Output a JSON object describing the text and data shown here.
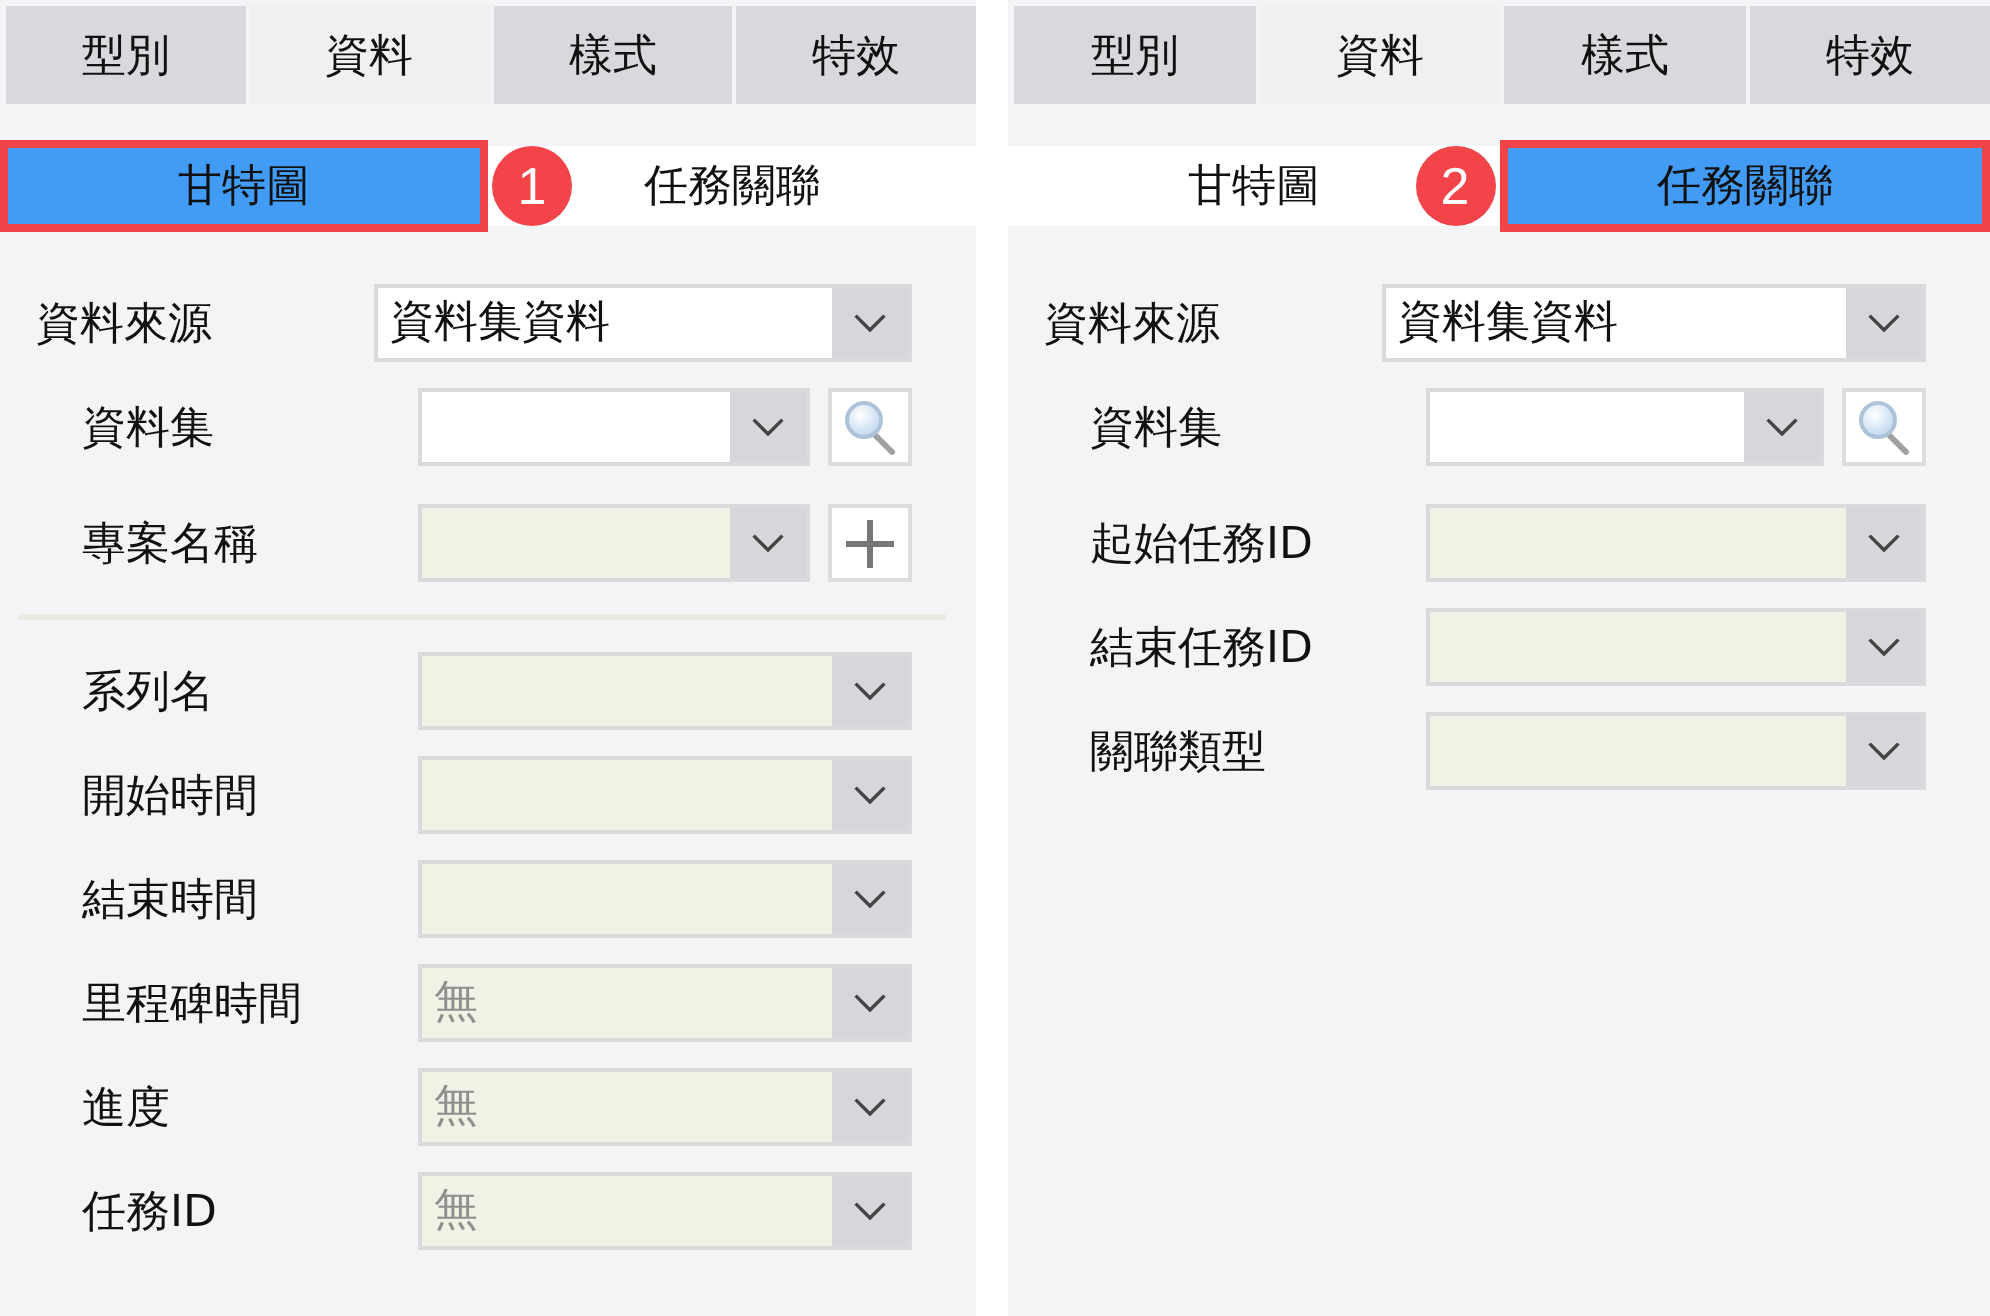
{
  "panels": [
    {
      "tabs": [
        {
          "label": "型別",
          "selected": false
        },
        {
          "label": "資料",
          "selected": true
        },
        {
          "label": "樣式",
          "selected": false
        },
        {
          "label": "特效",
          "selected": false
        }
      ],
      "subtabs": [
        {
          "label": "甘特圖",
          "selected": true,
          "highlighted": true,
          "badge": "1"
        },
        {
          "label": "任務關聯",
          "selected": false,
          "highlighted": false
        }
      ],
      "data_source": {
        "label": "資料來源",
        "value": "資料集資料",
        "dataset": {
          "label": "資料集",
          "disabled": false
        }
      },
      "groups": [
        [
          {
            "label": "專案名稱",
            "kind": "select_add",
            "disabled": true
          }
        ],
        [
          {
            "label": "系列名",
            "kind": "select",
            "disabled": true
          },
          {
            "label": "開始時間",
            "kind": "select",
            "disabled": true
          },
          {
            "label": "結束時間",
            "kind": "select",
            "disabled": true
          },
          {
            "label": "里程碑時間",
            "kind": "select",
            "value": "無",
            "disabled": true
          },
          {
            "label": "進度",
            "kind": "select",
            "value": "無",
            "disabled": true
          },
          {
            "label": "任務ID",
            "kind": "select",
            "value": "無",
            "disabled": true
          }
        ]
      ]
    },
    {
      "tabs": [
        {
          "label": "型別",
          "selected": false
        },
        {
          "label": "資料",
          "selected": true
        },
        {
          "label": "樣式",
          "selected": false
        },
        {
          "label": "特效",
          "selected": false
        }
      ],
      "subtabs": [
        {
          "label": "甘特圖",
          "selected": false,
          "highlighted": false
        },
        {
          "label": "任務關聯",
          "selected": true,
          "highlighted": true,
          "badge": "2"
        }
      ],
      "data_source": {
        "label": "資料來源",
        "value": "資料集資料",
        "dataset": {
          "label": "資料集",
          "disabled": false
        }
      },
      "groups": [
        [
          {
            "label": "起始任務ID",
            "kind": "select",
            "disabled": true
          },
          {
            "label": "結束任務ID",
            "kind": "select",
            "disabled": true
          },
          {
            "label": "關聯類型",
            "kind": "select",
            "disabled": true
          }
        ]
      ]
    }
  ]
}
